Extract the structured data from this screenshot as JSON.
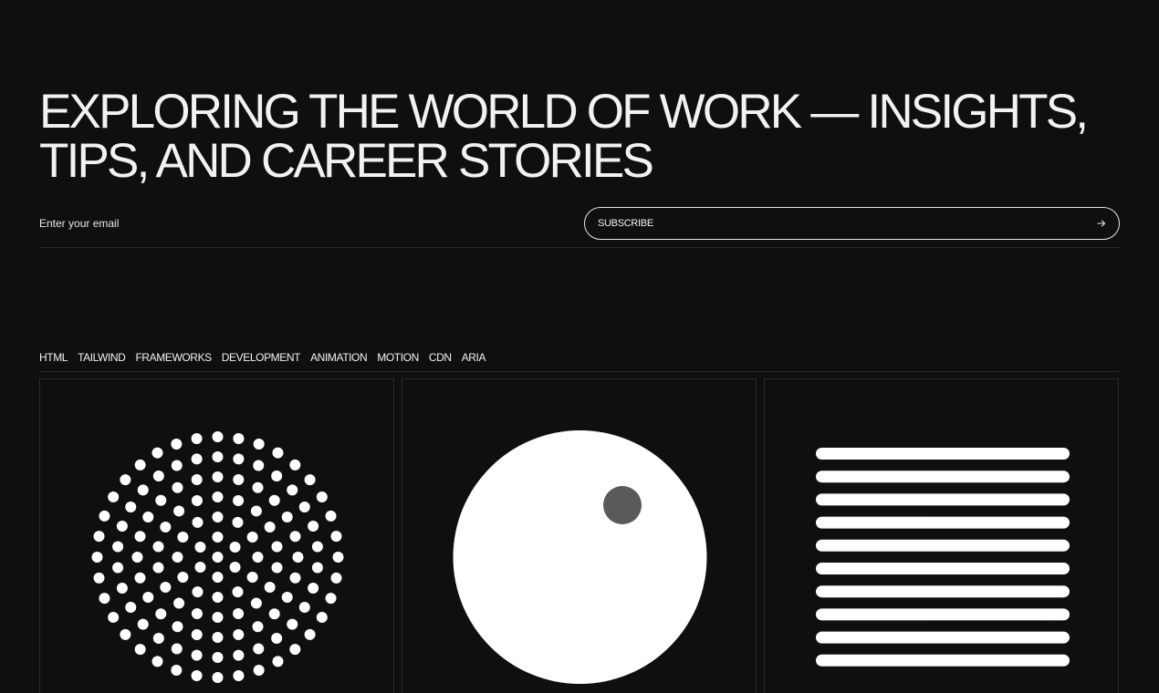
{
  "hero": {
    "title_line1": "EXPLORING THE WORLD OF WORK — INSIGHTS,",
    "title_line2": "TIPS, AND CAREER STORIES"
  },
  "subscribe": {
    "email_placeholder": "Enter your email",
    "button_label": "SUBSCRIBE",
    "button_icon": "arrow-right-icon"
  },
  "tags": [
    "HTML",
    "TAILWIND",
    "FRAMEWORKS",
    "DEVELOPMENT",
    "ANIMATION",
    "MOTION",
    "CDN",
    "ARIA"
  ],
  "cards": [
    {
      "illustration": "dot-sphere-icon"
    },
    {
      "illustration": "circle-with-dot-icon"
    },
    {
      "illustration": "stacked-lines-icon"
    }
  ],
  "colors": {
    "background": "#0f0f0f",
    "foreground": "#ffffff",
    "border": "#2a2a2a",
    "accent_dot": "#5a5a5a"
  }
}
